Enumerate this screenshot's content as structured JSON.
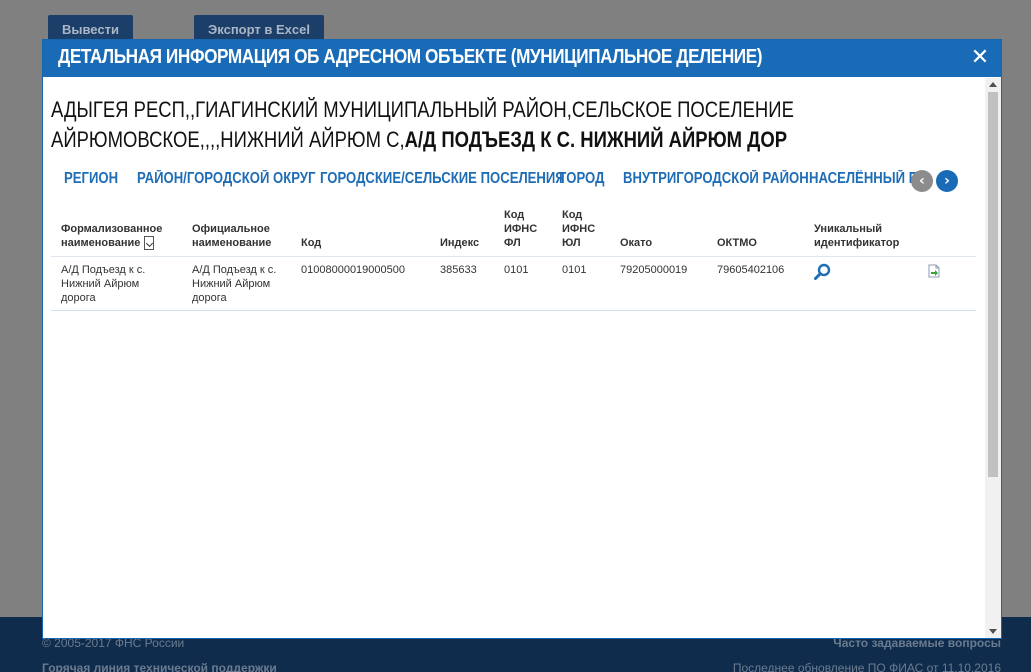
{
  "background": {
    "btn_output": "Вывести",
    "btn_export": "Экспорт в Excel",
    "copyright": "© 2005-2017 ФНС России",
    "faq": "Часто задаваемые вопросы",
    "hotline": "Горячая линия технической поддержки",
    "last_update": "Последнее обновление ПО ФИАС от 11.10.2016"
  },
  "modal": {
    "title": "ДЕТАЛЬНАЯ ИНФОРМАЦИЯ ОБ АДРЕСНОМ ОБЪЕКТЕ (МУНИЦИПАЛЬНОЕ ДЕЛЕНИЕ)",
    "close_icon": "close-icon",
    "address_prefix": "АДЫГЕЯ РЕСП,,ГИАГИНСКИЙ МУНИЦИПАЛЬНЫЙ РАЙОН,СЕЛЬСКОЕ ПОСЕЛЕНИЕ АЙРЮМОВСКОЕ,,,,НИЖНИЙ АЙРЮМ С,",
    "address_bold": "А/Д ПОДЪЕЗД К С. НИЖНИЙ АЙРЮМ ДОР"
  },
  "tabs": [
    "РЕГИОН",
    "РАЙОН/ГОРОДСКОЙ ОКРУГ",
    "ГОРОДСКИЕ/СЕЛЬСКИЕ ПОСЕЛЕНИЯ",
    "ГОРОД",
    "ВНУТРИГОРОДСКОЙ РАЙОН",
    "НАСЕЛЁННЫЙ ПУ"
  ],
  "tab_nav": {
    "prev_icon": "chevron-left-icon",
    "next_icon": "chevron-right-icon",
    "prev_color": "#8c8c8c",
    "next_color": "#1a6bb7"
  },
  "table": {
    "headers": {
      "formal_name": "Формализованное наименование",
      "official_name": "Официальное наименование",
      "code": "Код",
      "index": "Индекс",
      "ifns_fl": "Код ИФНС ФЛ",
      "ifns_ul": "Код ИФНС ЮЛ",
      "okato": "Окато",
      "oktmo": "ОКТМО",
      "unique_id": "Уникальный идентификатор"
    },
    "rows": [
      {
        "formal_name": "А/Д Подъезд к с. Нижний Айрюм дорога",
        "official_name": "А/Д Подъезд к с. Нижний Айрюм дорога",
        "code": "01008000019000500",
        "index": "385633",
        "ifns_fl": "0101",
        "ifns_ul": "0101",
        "okato": "79205000019",
        "oktmo": "79605402106",
        "id_icon": "search-icon",
        "export_icon": "export-document-icon"
      }
    ]
  },
  "colors": {
    "header_blue": "#1a6bb7",
    "link_blue": "#1f6db5"
  }
}
